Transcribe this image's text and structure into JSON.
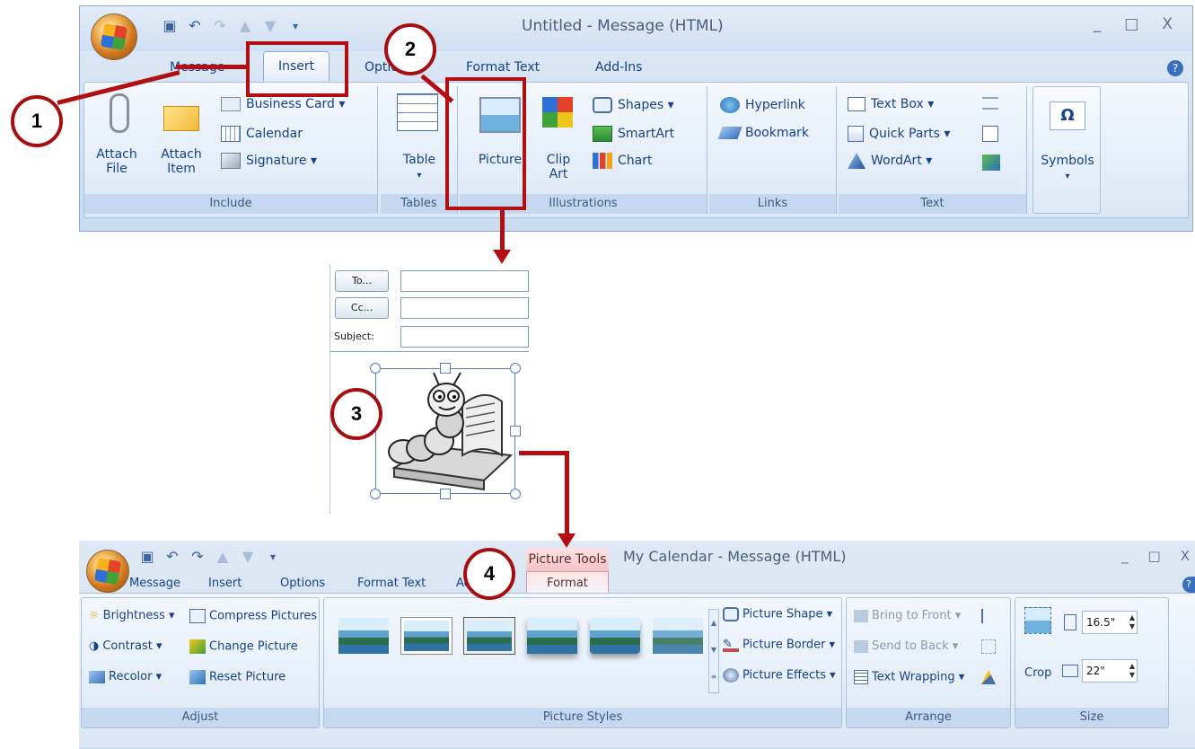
{
  "top_window": {
    "title": "Untitled - Message (HTML)",
    "tabs": [
      "Message",
      "Insert",
      "Options",
      "Format Text",
      "Add-Ins"
    ],
    "active_tab": "Insert",
    "controls": {
      "minimize": "_",
      "maximize": "□",
      "close": "X"
    },
    "help": "?",
    "groups": {
      "include": {
        "label": "Include",
        "attach_file": "Attach\nFile",
        "attach_file_l1": "Attach",
        "attach_file_l2": "File",
        "attach_item_l1": "Attach",
        "attach_item_l2": "Item",
        "business_card": "Business Card ▾",
        "calendar": "Calendar",
        "signature": "Signature ▾"
      },
      "tables": {
        "label": "Tables",
        "table": "Table",
        "arrow": "▾"
      },
      "illustrations": {
        "label": "Illustrations",
        "picture": "Picture",
        "clip_art_l1": "Clip",
        "clip_art_l2": "Art",
        "shapes": "Shapes ▾",
        "smartart": "SmartArt",
        "chart": "Chart"
      },
      "links": {
        "label": "Links",
        "hyperlink": "Hyperlink",
        "bookmark": "Bookmark"
      },
      "text": {
        "label": "Text",
        "text_box": "Text Box ▾",
        "quick_parts": "Quick Parts ▾",
        "wordart": "WordArt ▾"
      },
      "symbols": {
        "label": "Symbols",
        "omega": "Ω",
        "arrow": "▾"
      }
    }
  },
  "mail": {
    "to_button": "To...",
    "cc_button": "Cc...",
    "subject_label": "Subject:"
  },
  "bottom_window": {
    "title": "My Calendar - Message (HTML)",
    "context_tab": "Picture Tools",
    "tabs": [
      "Message",
      "Insert",
      "Options",
      "Format Text",
      "Add-Ins"
    ],
    "active_tab": "Format",
    "controls": {
      "minimize": "_",
      "maximize": "□",
      "close": "X"
    },
    "help": "?",
    "groups": {
      "adjust": {
        "label": "Adjust",
        "brightness": "Brightness ▾",
        "contrast": "Contrast ▾",
        "recolor": "Recolor ▾",
        "compress": "Compress Pictures",
        "change": "Change Picture",
        "reset": "Reset Picture"
      },
      "picture_styles": {
        "label": "Picture Styles",
        "shape": "Picture Shape ▾",
        "border": "Picture Border ▾",
        "effects": "Picture Effects ▾"
      },
      "arrange": {
        "label": "Arrange",
        "bring_front": "Bring to Front ▾",
        "send_back": "Send to Back ▾",
        "text_wrapping": "Text Wrapping ▾"
      },
      "size": {
        "label": "Size",
        "crop": "Crop",
        "height": "16.5\"",
        "width": "22\""
      }
    }
  },
  "annotations": [
    "1",
    "2",
    "3",
    "4"
  ]
}
